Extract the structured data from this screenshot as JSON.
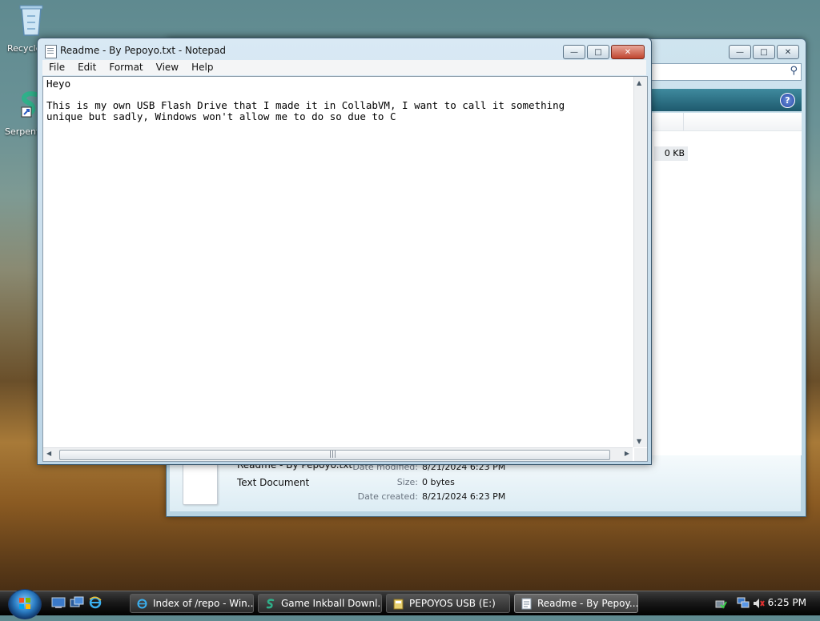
{
  "desktop": {
    "icons": [
      {
        "label": "Recycle",
        "icon": "recycle-bin-icon"
      },
      {
        "label": "Serpent",
        "icon": "serpent-icon"
      }
    ]
  },
  "explorer": {
    "size_cell": "0 KB",
    "details": {
      "file_name": "Readme - By Pepoyo.txt",
      "file_type": "Text Document",
      "date_modified_label": "Date modified:",
      "date_modified": "8/21/2024 6:23 PM",
      "size_label": "Size:",
      "size": "0 bytes",
      "date_created_label": "Date created:",
      "date_created": "8/21/2024 6:23 PM"
    }
  },
  "notepad": {
    "title": "Readme - By Pepoyo.txt - Notepad",
    "menu": [
      "File",
      "Edit",
      "Format",
      "View",
      "Help"
    ],
    "text": "Heyo\n\nThis is my own USB Flash Drive that I made it in CollabVM, I want to call it something\nunique but sadly, Windows won't allow me to do so due to C"
  },
  "taskbar": {
    "buttons": [
      {
        "label": "Index of /repo - Win...",
        "icon": "internet-explorer-icon"
      },
      {
        "label": "Game Inkball Downl...",
        "icon": "serpent-icon"
      },
      {
        "label": "PEPOYOS USB (E:)",
        "icon": "drive-icon"
      },
      {
        "label": "Readme - By Pepoy...",
        "icon": "notepad-icon"
      }
    ],
    "clock": "6:25 PM"
  },
  "colors": {
    "explorer_accent": "#2a6a7e",
    "close_button": "#c0452f",
    "taskbar": "#1a1a1a"
  }
}
